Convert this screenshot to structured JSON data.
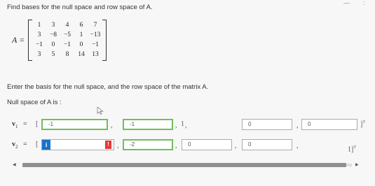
{
  "problem": {
    "title": "Find bases for the null space and row space of A.",
    "matrix_label": "A =",
    "matrix": [
      [
        "1",
        "3",
        "4",
        "6",
        "7"
      ],
      [
        "3",
        "−8",
        "−5",
        "1",
        "−13"
      ],
      [
        "−1",
        "0",
        "−1",
        "0",
        "−1"
      ],
      [
        "3",
        "5",
        "8",
        "14",
        "13"
      ]
    ],
    "instructions": "Enter the basis for the null space, and the row space of the matrix A.",
    "null_space_label": "Null space of A is :"
  },
  "corner_marks": [
    "—",
    ":"
  ],
  "vectors": {
    "v1": {
      "label": "v",
      "subscript": "1",
      "equals": "=",
      "open_bracket": "[",
      "inputs": [
        "-1",
        "-1",
        "0",
        "0"
      ],
      "fixed_value": "1",
      "close": "]",
      "superscript": "T"
    },
    "v2": {
      "label": "v",
      "subscript": "2",
      "equals": "=",
      "open_bracket": "[",
      "inputs": [
        "",
        "-2",
        "0",
        "0"
      ],
      "fixed_value": "1",
      "close": "]",
      "superscript": "T",
      "info_icon": "i",
      "error_icon": "!"
    }
  },
  "separators": {
    "comma": ","
  },
  "scroll": {
    "left_arrow": "◀",
    "right_arrow": "▶"
  },
  "colors": {
    "info": "#1a73c9",
    "error": "#e53935",
    "focus": "#6fbf5a"
  }
}
